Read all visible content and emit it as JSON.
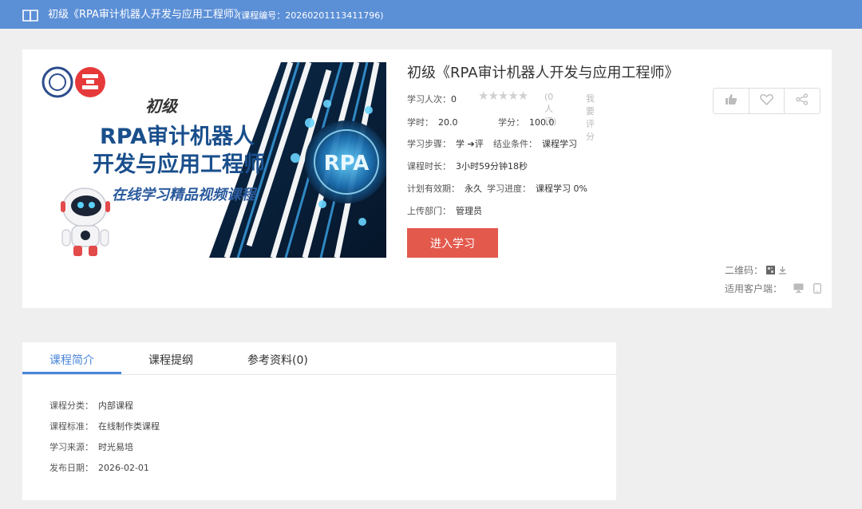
{
  "header": {
    "title": "初级《RPA审计机器人开发与应用工程师》",
    "code": "(课程编号：20260201113411796)"
  },
  "cover": {
    "level": "初级",
    "line1": "RPA审计机器人",
    "line2": "开发与应用工程师",
    "line3": "在线学习精品视频课程",
    "rpa_badge": "RPA",
    "accent": "#1a4f8c"
  },
  "course": {
    "title": "初级《RPA审计机器人开发与应用工程师》",
    "learners_label": "学习人次：",
    "learners_value": "0",
    "rating_count": "(0 人评)",
    "rate_link": "我要评分",
    "hours_label": "学时：",
    "hours_value": "20.0",
    "credits_label": "学分：",
    "credits_value": "100.0",
    "steps_label": "学习步骤：",
    "steps_value": "学 ➔评",
    "completion_label": "结业条件：",
    "completion_value": "课程学习",
    "duration_label": "课程时长：",
    "duration_value": "3小时59分钟18秒",
    "validity_label": "计划有效期：",
    "validity_value": "永久",
    "progress_label": "学习进度：",
    "progress_value": "课程学习  0%",
    "dept_label": "上传部门：",
    "dept_value": "管理员",
    "enter_button": "进入学习",
    "qr_label": "二维码：",
    "client_label": "适用客户端："
  },
  "tabs": [
    {
      "label": "课程简介"
    },
    {
      "label": "课程提纲"
    },
    {
      "label": "参考资料(0)"
    }
  ],
  "intro": {
    "category_label": "课程分类：",
    "category_value": "内部课程",
    "standard_label": "课程标准：",
    "standard_value": "在线制作类课程",
    "source_label": "学习来源：",
    "source_value": "时光易培",
    "date_label": "发布日期：",
    "date_value": "2026-02-01"
  },
  "colors": {
    "topbar": "#5b8fd6",
    "button": "#e35a4d",
    "active_tab": "#4a86d8"
  }
}
